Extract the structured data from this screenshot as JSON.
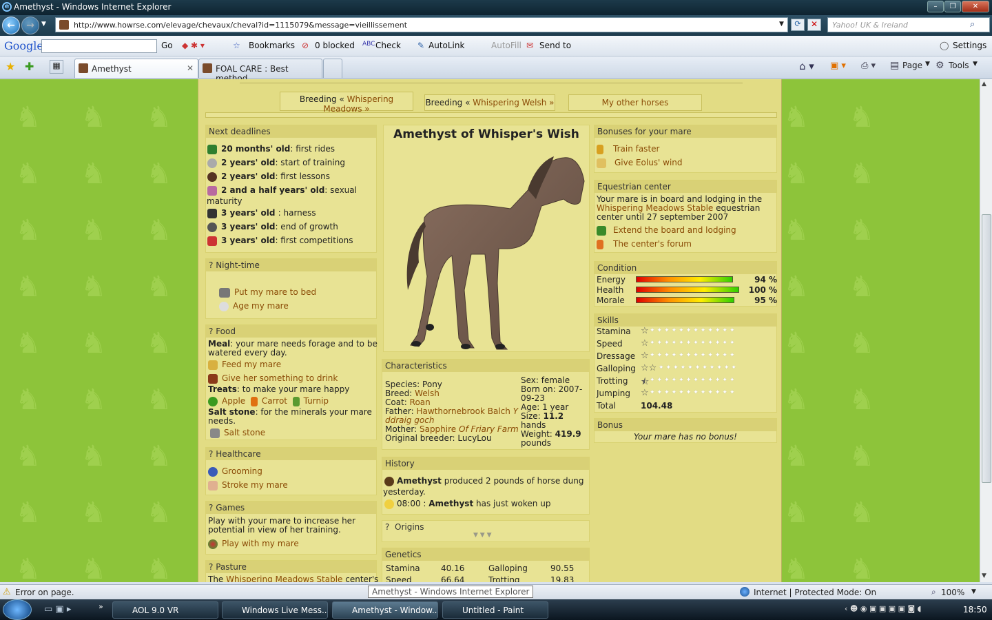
{
  "window": {
    "title": "Amethyst - Windows Internet Explorer"
  },
  "address": {
    "url": "http://www.howrse.com/elevage/chevaux/cheval?id=1115079&message=vieillissement",
    "search_placeholder": "Yahoo! UK & Ireland"
  },
  "gtoolbar": {
    "google": "Google",
    "go": "Go",
    "bookmarks": "Bookmarks",
    "blocked": "0 blocked",
    "check": "Check",
    "autolink": "AutoLink",
    "autofill": "AutoFill",
    "sendto": "Send to",
    "settings": "Settings"
  },
  "tabs": [
    {
      "label": "Amethyst"
    },
    {
      "label": "FOAL CARE : Best method ..."
    }
  ],
  "cmdbar": {
    "page": "Page",
    "tools": "Tools"
  },
  "nav": {
    "tab1a": "Breeding « ",
    "tab1b": "Whispering Meadows »",
    "tab2a": "Breeding « ",
    "tab2b": "Whispering Welsh »",
    "tab3": "My other horses"
  },
  "deadlines": {
    "title": "Next deadlines",
    "items": [
      {
        "b": "20 months' old",
        "t": ": first rides"
      },
      {
        "b": "2 years' old",
        "t": ": start of training"
      },
      {
        "b": "2 years' old",
        "t": ": first lessons"
      },
      {
        "b": "2 and a half years' old",
        "t": ": sexual"
      },
      {
        "b": "3 years' old ",
        "t": ": harness"
      },
      {
        "b": "3 years' old",
        "t": ": end of growth"
      },
      {
        "b": "3 years' old",
        "t": ": first competitions"
      }
    ],
    "wrap": "maturity"
  },
  "night": {
    "title": "Night-time",
    "bed": "Put my mare to bed",
    "age": "Age my mare"
  },
  "food": {
    "title": "Food",
    "meal_b": "Meal",
    "meal_t": ": your mare needs forage and to be",
    "meal_t2": "watered every day.",
    "feed": "Feed my mare",
    "drink": "Give her something to drink",
    "treats_b": "Treats",
    "treats_t": ": to make your mare happy",
    "apple": "Apple",
    "carrot": "Carrot",
    "turnip": "Turnip",
    "salt_b": "Salt stone",
    "salt_t": ": for the minerals your mare",
    "salt_t2": "needs.",
    "salt_link": "Salt stone"
  },
  "health": {
    "title": "Healthcare",
    "groom": "Grooming",
    "stroke": "Stroke my mare"
  },
  "games": {
    "title": "Games",
    "t1": "Play with your mare to increase her",
    "t2": "potential in view of her training.",
    "play": "Play with my mare"
  },
  "pasture": {
    "title": "Pasture",
    "t1": "The ",
    "t1link": "Whispering Meadows Stable",
    "t2": " center's"
  },
  "horse": {
    "name": "Amethyst of Whisper's Wish"
  },
  "chars": {
    "title": "Characteristics",
    "species": "Species: Pony",
    "breed_l": "Breed: ",
    "breed": "Welsh",
    "coat_l": "Coat: ",
    "coat": "Roan",
    "father_l": "Father: ",
    "father": "Hawthornebrook Balch",
    "father_aff": "Y",
    "father_aff2": "ddraig goch",
    "mother_l": "Mother: ",
    "mother": "Sapphire",
    "mother_aff": "Of Friary Farm",
    "breeder": "Original breeder: LucyLou",
    "sex": "Sex: female",
    "born1": "Born on: 2007-",
    "born2": "09-23",
    "age_l": "Age: ",
    "age": "1 year",
    "size_l": "Size: ",
    "size": "11.2",
    "size_u": "hands",
    "weight_l": "Weight: ",
    "weight": "419.9",
    "weight_u": "pounds"
  },
  "history": {
    "title": "History",
    "e1_b": "Amethyst",
    "e1_t": " produced 2 pounds of horse dung",
    "e1_t2": "yesterday.",
    "e2_time": "08:00 : ",
    "e2_b": "Amethyst",
    "e2_t": " has just woken up"
  },
  "origins": {
    "title": "Origins"
  },
  "genetics": {
    "title": "Genetics",
    "rows": [
      {
        "a": "Stamina",
        "av": "40.16",
        "b": "Galloping",
        "bv": "90.55"
      },
      {
        "a": "Speed",
        "av": "66.64",
        "b": "Trotting",
        "bv": "19.83"
      }
    ]
  },
  "bonuses": {
    "title": "Bonuses for your mare",
    "train": "Train faster",
    "eolus": "Give Eolus' wind"
  },
  "equestrian": {
    "title": "Equestrian center",
    "t1": "Your mare is in board and lodging in the",
    "t2link": "Whispering Meadows Stable",
    "t2": " equestrian",
    "t3": "center until 27 september 2007",
    "extend": "Extend the board and lodging",
    "forum": "The center's forum"
  },
  "condition": {
    "title": "Condition",
    "rows": [
      {
        "label": "Energy",
        "value": "94 %",
        "pct": 94
      },
      {
        "label": "Health",
        "value": "100 %",
        "pct": 100
      },
      {
        "label": "Morale",
        "value": "95 %",
        "pct": 95
      }
    ]
  },
  "skills": {
    "title": "Skills",
    "rows": [
      {
        "label": "Stamina",
        "stars": 1
      },
      {
        "label": "Speed",
        "stars": 1
      },
      {
        "label": "Dressage",
        "stars": 1
      },
      {
        "label": "Galloping",
        "stars": 2
      },
      {
        "label": "Trotting",
        "stars": 0.5
      },
      {
        "label": "Jumping",
        "stars": 1
      }
    ],
    "total_l": "Total",
    "total": "104.48"
  },
  "bonus": {
    "title": "Bonus",
    "text": "Your mare has no bonus!"
  },
  "statusbar": {
    "error": "Error on page.",
    "tooltip": "Amethyst - Windows Internet Explorer",
    "zone": "Internet | Protected Mode: On",
    "zoom": "100%"
  },
  "taskbar": {
    "items": [
      "AOL 9.0 VR",
      "Windows Live Mess...",
      "Amethyst - Window...",
      "Untitled - Paint"
    ],
    "clock": "18:50"
  }
}
